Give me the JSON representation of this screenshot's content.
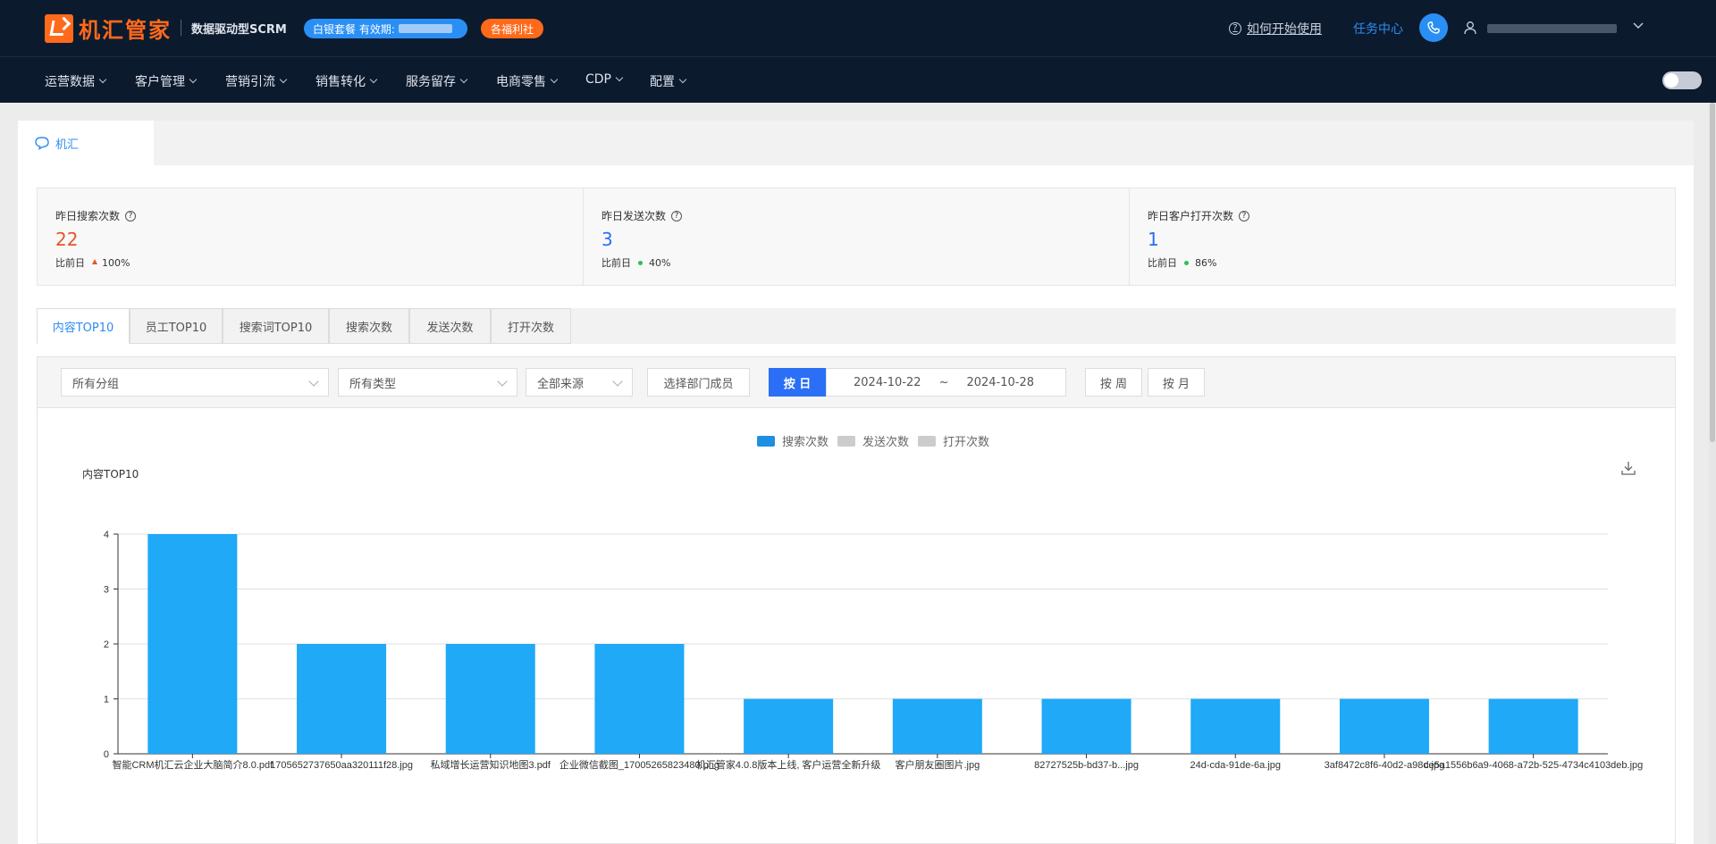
{
  "header": {
    "logo_text": "机汇管家",
    "subtitle": "数据驱动型SCRM",
    "package_label": "白银套餐 有效期:",
    "welfare_label": "各福利社",
    "help_link": "如何开始使用",
    "task_center": "任务中心",
    "colors": {
      "bg": "#0c1a2e",
      "brand": "#ff6a1a",
      "accent": "#2a8ff5"
    }
  },
  "nav": {
    "items": [
      {
        "label": "运营数据"
      },
      {
        "label": "客户管理"
      },
      {
        "label": "营销引流"
      },
      {
        "label": "销售转化"
      },
      {
        "label": "服务留存"
      },
      {
        "label": "电商零售"
      },
      {
        "label": "CDP"
      },
      {
        "label": "配置"
      }
    ]
  },
  "page_tab": {
    "label": "机汇"
  },
  "stats": [
    {
      "label": "昨日搜索次数",
      "value": "22",
      "compare_label": "比前日",
      "compare_value": "100%",
      "trend": "up",
      "value_color": "#e4552b"
    },
    {
      "label": "昨日发送次数",
      "value": "3",
      "compare_label": "比前日",
      "compare_value": "40%",
      "trend": "dot",
      "value_color": "#2a6ff5"
    },
    {
      "label": "昨日客户打开次数",
      "value": "1",
      "compare_label": "比前日",
      "compare_value": "86%",
      "trend": "dot",
      "value_color": "#2a6ff5"
    }
  ],
  "tabs": [
    {
      "label": "内容TOP10",
      "active": true
    },
    {
      "label": "员工TOP10"
    },
    {
      "label": "搜索词TOP10"
    },
    {
      "label": "搜索次数"
    },
    {
      "label": "发送次数"
    },
    {
      "label": "打开次数"
    }
  ],
  "filters": {
    "group_select": "所有分组",
    "type_select": "所有类型",
    "source_select": "全部来源",
    "dept_button": "选择部门成员",
    "by_day": "按 日",
    "start_date": "2024-10-22",
    "date_sep": "~",
    "end_date": "2024-10-28",
    "by_week": "按 周",
    "by_month": "按 月"
  },
  "chart_data": {
    "type": "bar",
    "title": "内容TOP10",
    "legend": [
      {
        "name": "搜索次数",
        "color": "#1fa9f7"
      },
      {
        "name": "发送次数",
        "color": "#cccccc"
      },
      {
        "name": "打开次数",
        "color": "#cccccc"
      }
    ],
    "categories": [
      "智能CRM机汇云企业大脑简介8.0.pdf",
      "1705652737650aa320111f28.jpg",
      "私域增长运营知识地图3.pdf",
      "企业微信截图_17005265823480.png",
      "机汇管家4.0.8版本上线, 客户运营全新升级",
      "客户朋友圈图片.jpg",
      "82727525b-bd37-b...jpg",
      "24d-cda-91de-6a.jpg",
      "3af8472c8f6-40d2-a98d.jpg",
      "ce5a1556b6a9-4068-a72b-525-4734c4103deb.jpg"
    ],
    "series": [
      {
        "name": "搜索次数",
        "values": [
          4,
          2,
          2,
          2,
          1,
          1,
          1,
          1,
          1,
          1
        ]
      }
    ],
    "y_ticks": [
      "0",
      "1",
      "2",
      "3",
      "4"
    ],
    "ylim": [
      0,
      4
    ],
    "grid": true,
    "legend_position": "top-center"
  }
}
